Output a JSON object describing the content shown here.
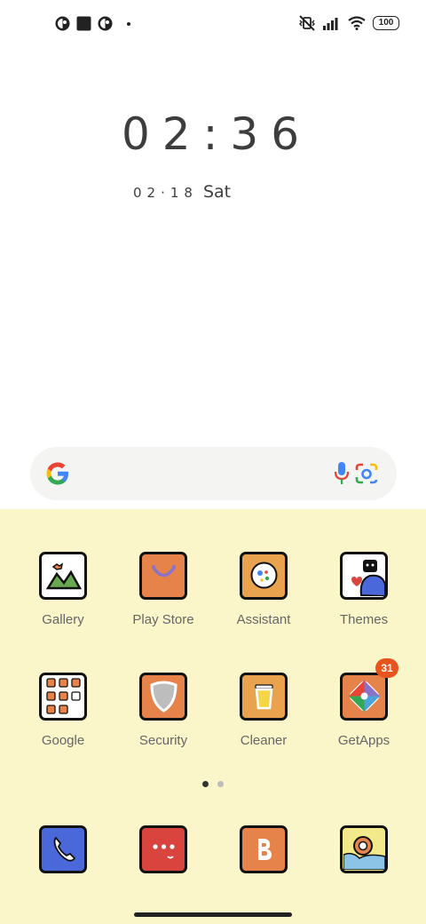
{
  "status_bar": {
    "left_icons": [
      "notification-app-icon",
      "square-app-icon",
      "notification-app-icon"
    ],
    "right_icons": [
      "vibrate-off-icon",
      "signal-icon",
      "wifi-icon"
    ],
    "battery": "100"
  },
  "clock": {
    "time": "02:36",
    "date": "02·18",
    "weekday": "Sat"
  },
  "search": {
    "icons": [
      "google-logo-icon",
      "microphone-icon",
      "google-lens-icon"
    ]
  },
  "apps": {
    "row1": [
      {
        "label": "Gallery",
        "icon": "gallery-icon",
        "color": "#ffffff"
      },
      {
        "label": "Play Store",
        "icon": "play-store-icon",
        "color": "#e5834a"
      },
      {
        "label": "Assistant",
        "icon": "assistant-icon",
        "color": "#e9a24e"
      },
      {
        "label": "Themes",
        "icon": "themes-icon",
        "color": "#ffffff"
      }
    ],
    "row2": [
      {
        "label": "Google",
        "icon": "google-folder-icon",
        "color": "#ffffff"
      },
      {
        "label": "Security",
        "icon": "security-icon",
        "color": "#e5834a"
      },
      {
        "label": "Cleaner",
        "icon": "cleaner-icon",
        "color": "#e9a24e"
      },
      {
        "label": "GetApps",
        "icon": "getapps-icon",
        "color": "#e5834a",
        "badge": "31"
      }
    ],
    "dock": [
      {
        "icon": "phone-icon",
        "color": "#4a68d9"
      },
      {
        "icon": "messages-icon",
        "color": "#d9443f"
      },
      {
        "icon": "browser-icon",
        "color": "#e5834a"
      },
      {
        "icon": "camera-icon",
        "color": "#f2ea8a"
      }
    ]
  },
  "pages": {
    "count": 2,
    "current": 1
  },
  "colors": {
    "launcher_bg": "#fbf5ca",
    "badge": "#e8541e"
  }
}
